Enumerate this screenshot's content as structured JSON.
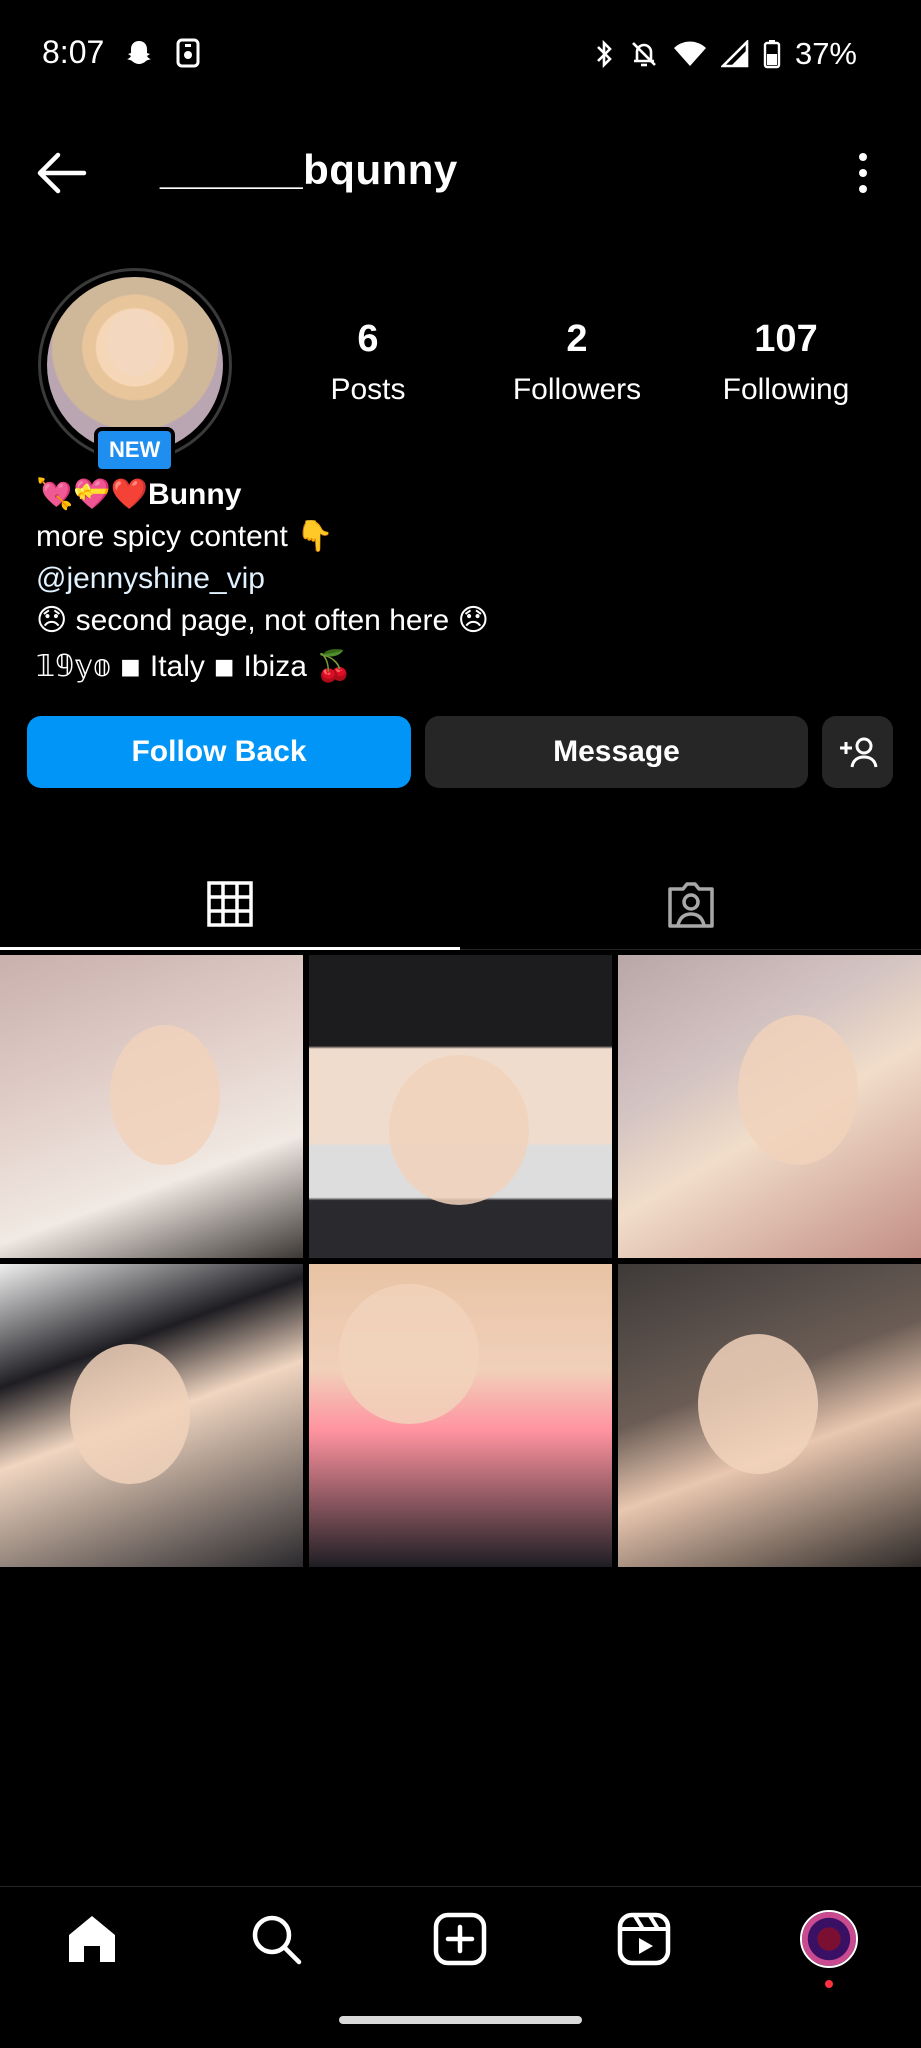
{
  "status_bar": {
    "time": "8:07",
    "battery_percent": "37%",
    "icons_left": [
      "snapchat-icon",
      "notification-app-icon"
    ],
    "icons_right": [
      "bluetooth-icon",
      "bell-off-icon",
      "wifi-icon",
      "signal-icon",
      "battery-icon"
    ]
  },
  "header": {
    "username": "______bqunny"
  },
  "profile": {
    "badge": "NEW",
    "stats": [
      {
        "value": "6",
        "label": "Posts"
      },
      {
        "value": "2",
        "label": "Followers"
      },
      {
        "value": "107",
        "label": "Following"
      }
    ],
    "bio": {
      "name": "💘💝❤️Bunny",
      "line1": "more spicy content 👇",
      "link": "@jennyshine_vip",
      "line3": "😞 second page, not often here 😞",
      "line4": "𝟙𝟡𝕪𝕠 ◾ Italy ◾ Ibiza 🍒"
    }
  },
  "actions": {
    "follow_back": "Follow Back",
    "message": "Message"
  },
  "tabs": [
    "grid-tab",
    "tagged-tab"
  ],
  "posts_count_shown": 6,
  "colors": {
    "accent_blue": "#0095f6",
    "button_dark": "#262626",
    "background": "#000000",
    "new_badge": "#1e8ef0",
    "notification_dot": "#ff3040"
  }
}
